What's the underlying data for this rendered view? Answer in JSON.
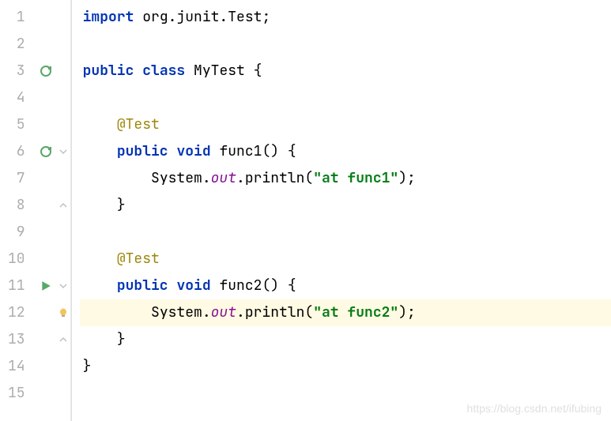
{
  "lines": {
    "n1": "1",
    "n2": "2",
    "n3": "3",
    "n4": "4",
    "n5": "5",
    "n6": "6",
    "n7": "7",
    "n8": "8",
    "n9": "9",
    "n10": "10",
    "n11": "11",
    "n12": "12",
    "n13": "13",
    "n14": "14",
    "n15": "15"
  },
  "code": {
    "l1": {
      "kw1": "import",
      "pkg": " org.junit.",
      "cls": "Test",
      "end": ";"
    },
    "l3": {
      "kw1": "public",
      "kw2": "class",
      "cls": "MyTest",
      "brace": " {"
    },
    "l5": {
      "indent": "    ",
      "anno": "@Test"
    },
    "l6": {
      "indent": "    ",
      "kw1": "public",
      "kw2": "void",
      "method": "func1",
      "parens": "() {"
    },
    "l7": {
      "indent": "        ",
      "sys": "System.",
      "out": "out",
      "print": ".println(",
      "str": "\"at func1\"",
      "end": ");"
    },
    "l8": {
      "indent": "    ",
      "brace": "}"
    },
    "l10": {
      "indent": "    ",
      "anno": "@Test"
    },
    "l11": {
      "indent": "    ",
      "kw1": "public",
      "kw2": "void",
      "method": "func2",
      "parens": "() {"
    },
    "l12": {
      "indent": "        ",
      "sys": "System.",
      "out": "out",
      "print": ".println(",
      "str": "\"at func2\"",
      "end": ");"
    },
    "l13": {
      "indent": "    ",
      "brace": "}"
    },
    "l14": {
      "brace": "}"
    }
  },
  "watermark": "https://blog.csdn.net/ifubing"
}
